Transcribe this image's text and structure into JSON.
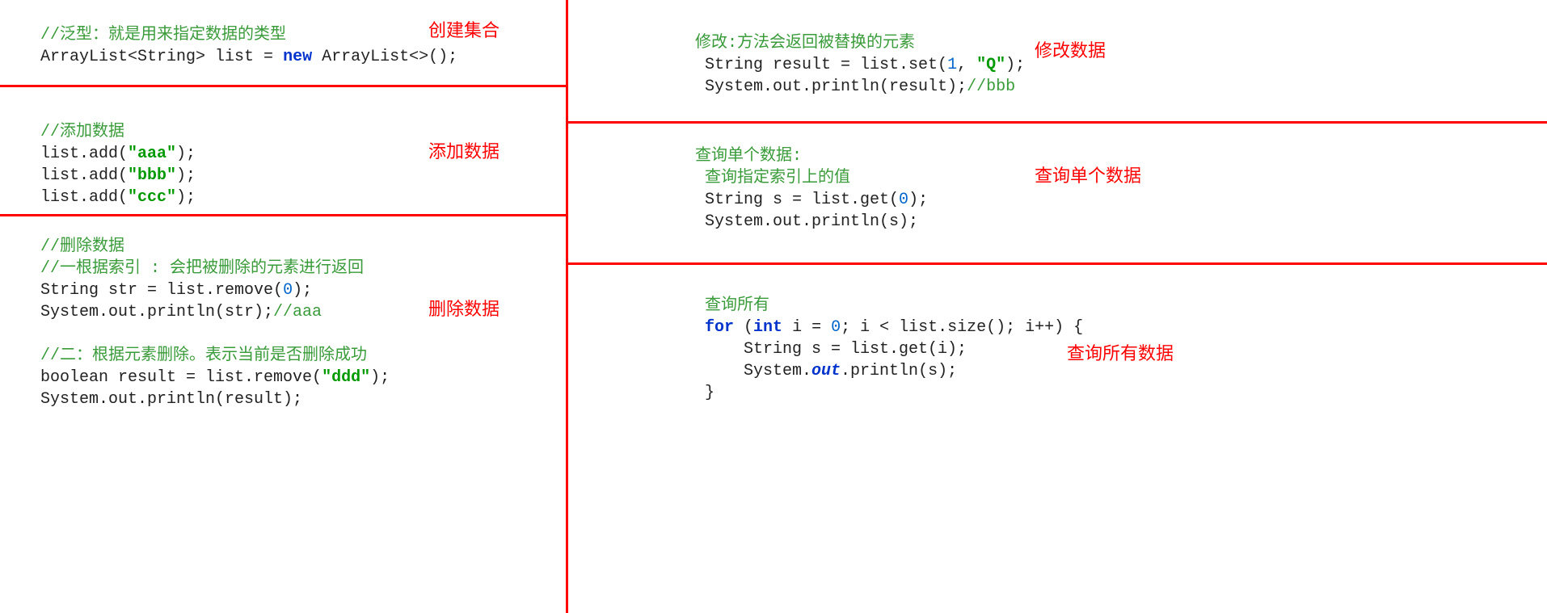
{
  "badges": {
    "create": "创建集合",
    "add": "添加数据",
    "remove": "删除数据",
    "modify": "修改数据",
    "queryOne": "查询单个数据",
    "queryAll": "查询所有数据"
  },
  "cell1": {
    "c1": "//泛型：就是用来指定数据的类型",
    "l2a": "ArrayList<String> list = ",
    "l2b": "new",
    "l2c": " ArrayList<>();"
  },
  "cell2": {
    "c1": "//添加数据",
    "l2a": "list.add(",
    "l2b": "\"aaa\"",
    "l2c": ");",
    "l3a": "list.add(",
    "l3b": "\"bbb\"",
    "l3c": ");",
    "l4a": "list.add(",
    "l4b": "\"ccc\"",
    "l4c": ");"
  },
  "cell3": {
    "c1": "//删除数据",
    "c2": "//一根据索引 : 会把被删除的元素进行返回",
    "l3a": "String str = list.remove(",
    "l3b": "0",
    "l3c": ");",
    "l4a": "System.out.println(str);",
    "l4b": "//aaa",
    "c5": "//二：根据元素删除。表示当前是否删除成功",
    "l6a": "boolean result = list.remove(",
    "l6b": "\"ddd\"",
    "l6c": ");",
    "l7": "System.out.println(result);"
  },
  "cell4": {
    "c1": "修改:方法会返回被替换的元素",
    "l2a": " String result = list.set(",
    "l2b": "1",
    "l2c": ", ",
    "l2d": "\"Q\"",
    "l2e": ");",
    "l3a": " System.out.println(result);",
    "l3b": "//bbb"
  },
  "cell5": {
    "c1": "查询单个数据:",
    "c2": " 查询指定索引上的值",
    "l3a": " String s = list.get(",
    "l3b": "0",
    "l3c": ");",
    "l4": " System.out.println(s);"
  },
  "cell6": {
    "c1": " 查询所有",
    "l2a": " ",
    "l2b": "for",
    "l2c": " (",
    "l2d": "int",
    "l2e": " i = ",
    "l2f": "0",
    "l2g": "; i < list.size(); i++) {",
    "l3a": "     String s = list.get(i);",
    "l4a": "     System.",
    "l4b": "out",
    "l4c": ".println(s);",
    "l5": " }"
  }
}
